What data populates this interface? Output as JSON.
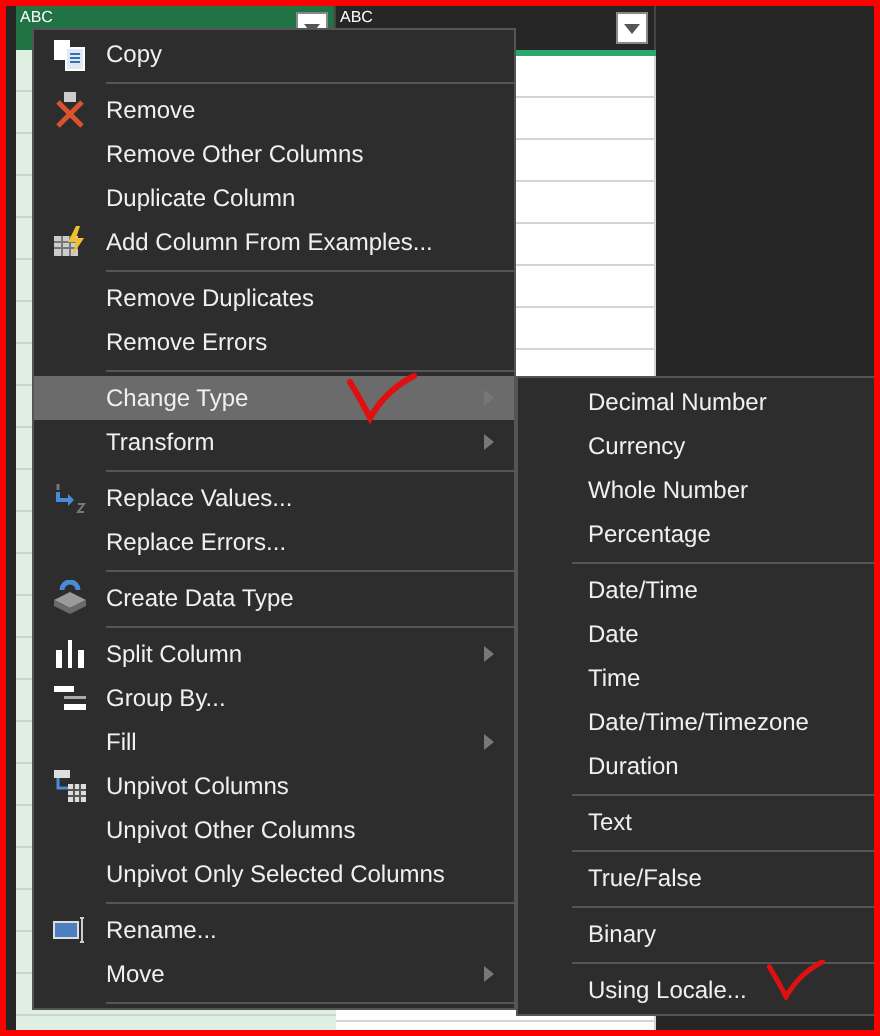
{
  "columns": [
    {
      "type_label": "ABC",
      "selected": true
    },
    {
      "type_label": "ABC",
      "selected": false
    }
  ],
  "context_menu": {
    "items": [
      {
        "kind": "item",
        "label": "Copy",
        "selected": false,
        "has_submenu": false
      },
      {
        "kind": "separator"
      },
      {
        "kind": "item",
        "label": "Remove",
        "selected": false,
        "has_submenu": false
      },
      {
        "kind": "item",
        "label": "Remove Other Columns",
        "selected": false,
        "has_submenu": false
      },
      {
        "kind": "item",
        "label": "Duplicate Column",
        "selected": false,
        "has_submenu": false
      },
      {
        "kind": "item",
        "label": "Add Column From Examples...",
        "selected": false,
        "has_submenu": false
      },
      {
        "kind": "separator"
      },
      {
        "kind": "item",
        "label": "Remove Duplicates",
        "selected": false,
        "has_submenu": false
      },
      {
        "kind": "item",
        "label": "Remove Errors",
        "selected": false,
        "has_submenu": false
      },
      {
        "kind": "separator"
      },
      {
        "kind": "item",
        "label": "Change Type",
        "selected": true,
        "has_submenu": true
      },
      {
        "kind": "item",
        "label": "Transform",
        "selected": false,
        "has_submenu": true
      },
      {
        "kind": "separator"
      },
      {
        "kind": "item",
        "label": "Replace Values...",
        "selected": false,
        "has_submenu": false
      },
      {
        "kind": "item",
        "label": "Replace Errors...",
        "selected": false,
        "has_submenu": false
      },
      {
        "kind": "separator"
      },
      {
        "kind": "item",
        "label": "Create Data Type",
        "selected": false,
        "has_submenu": false
      },
      {
        "kind": "separator"
      },
      {
        "kind": "item",
        "label": "Split Column",
        "selected": false,
        "has_submenu": true
      },
      {
        "kind": "item",
        "label": "Group By...",
        "selected": false,
        "has_submenu": false
      },
      {
        "kind": "item",
        "label": "Fill",
        "selected": false,
        "has_submenu": true
      },
      {
        "kind": "item",
        "label": "Unpivot Columns",
        "selected": false,
        "has_submenu": false
      },
      {
        "kind": "item",
        "label": "Unpivot Other Columns",
        "selected": false,
        "has_submenu": false
      },
      {
        "kind": "item",
        "label": "Unpivot Only Selected Columns",
        "selected": false,
        "has_submenu": false
      },
      {
        "kind": "separator"
      },
      {
        "kind": "item",
        "label": "Rename...",
        "selected": false,
        "has_submenu": false
      },
      {
        "kind": "item",
        "label": "Move",
        "selected": false,
        "has_submenu": true
      },
      {
        "kind": "separator"
      }
    ]
  },
  "submenu": {
    "items": [
      {
        "kind": "item",
        "label": "Decimal Number"
      },
      {
        "kind": "item",
        "label": "Currency"
      },
      {
        "kind": "item",
        "label": "Whole Number"
      },
      {
        "kind": "item",
        "label": "Percentage"
      },
      {
        "kind": "separator"
      },
      {
        "kind": "item",
        "label": "Date/Time"
      },
      {
        "kind": "item",
        "label": "Date"
      },
      {
        "kind": "item",
        "label": "Time"
      },
      {
        "kind": "item",
        "label": "Date/Time/Timezone"
      },
      {
        "kind": "item",
        "label": "Duration"
      },
      {
        "kind": "separator"
      },
      {
        "kind": "item",
        "label": "Text"
      },
      {
        "kind": "separator"
      },
      {
        "kind": "item",
        "label": "True/False"
      },
      {
        "kind": "separator"
      },
      {
        "kind": "item",
        "label": "Binary"
      },
      {
        "kind": "separator"
      },
      {
        "kind": "item",
        "label": "Using Locale..."
      }
    ]
  }
}
